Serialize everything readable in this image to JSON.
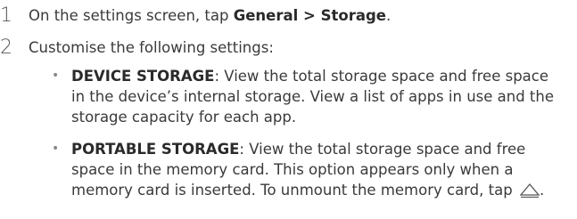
{
  "steps": [
    {
      "number": "1",
      "prefix": "On the settings screen, tap ",
      "bold": "General > Storage",
      "suffix": "."
    },
    {
      "number": "2",
      "text": "Customise the following settings:"
    }
  ],
  "bullets": [
    {
      "term": "DEVICE STORAGE",
      "desc": ": View the total storage space and free space in the device’s internal storage. View a list of apps in use and the storage capacity for each app."
    },
    {
      "term": "PORTABLE STORAGE",
      "desc": ": View the total storage space and free space in the memory card. This option appears only when a memory card is inserted. To unmount the memory card, tap ",
      "icon": "eject-icon",
      "after_icon": "."
    }
  ]
}
